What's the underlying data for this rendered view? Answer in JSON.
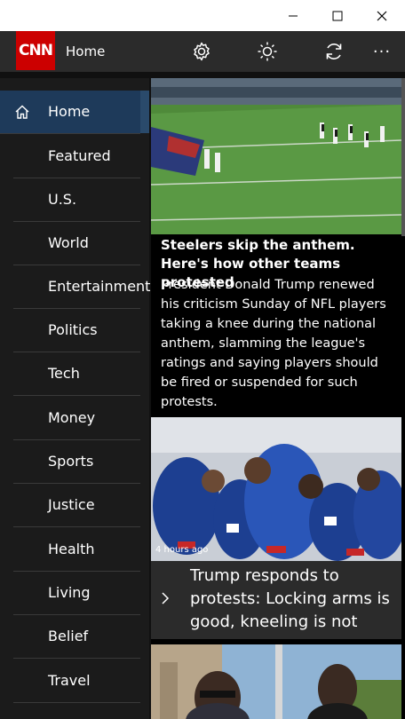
{
  "window": {
    "minimize_icon": "minimize-icon",
    "maximize_icon": "maximize-icon",
    "close_icon": "close-icon"
  },
  "app": {
    "logo_text": "CNN",
    "title": "Home"
  },
  "toolbar": {
    "settings_icon": "gear-icon",
    "brightness_icon": "sun-icon",
    "refresh_icon": "refresh-icon",
    "more_label": "···"
  },
  "sidebar": {
    "items": [
      {
        "label": "Home",
        "icon": "home-icon",
        "active": true
      },
      {
        "label": "Featured"
      },
      {
        "label": "U.S."
      },
      {
        "label": "World"
      },
      {
        "label": "Entertainment"
      },
      {
        "label": "Politics"
      },
      {
        "label": "Tech"
      },
      {
        "label": "Money"
      },
      {
        "label": "Sports"
      },
      {
        "label": "Justice"
      },
      {
        "label": "Health"
      },
      {
        "label": "Living"
      },
      {
        "label": "Belief"
      },
      {
        "label": "Travel"
      }
    ]
  },
  "articles": [
    {
      "headline": "Steelers skip the anthem. Here's how other teams protested",
      "summary": "President Donald Trump renewed his criticism Sunday of NFL players taking a knee during the national anthem, slamming the league's ratings and saying players should be fired or suspended for such protests."
    },
    {
      "timestamp": "4 hours ago",
      "headline": "Trump responds to protests: Locking arms is good, kneeling is not"
    }
  ],
  "colors": {
    "brand": "#cc0000",
    "nav_active": "#1e3a5a",
    "sidebar_bg": "#1b1b1b"
  }
}
